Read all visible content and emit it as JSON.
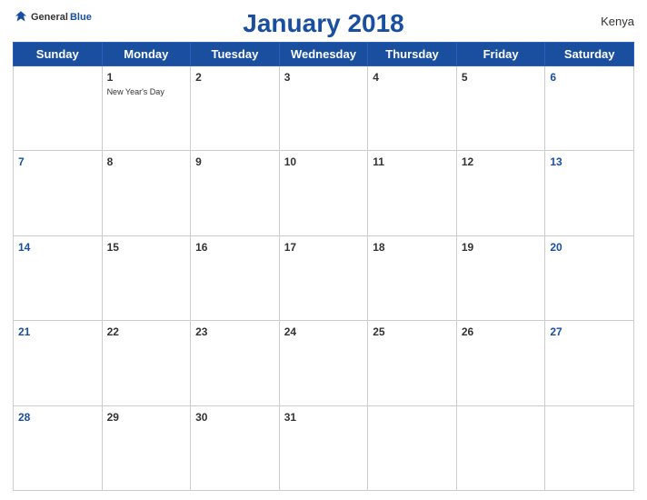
{
  "header": {
    "title": "January 2018",
    "country": "Kenya",
    "logo": {
      "general": "General",
      "blue": "Blue"
    }
  },
  "days_of_week": [
    "Sunday",
    "Monday",
    "Tuesday",
    "Wednesday",
    "Thursday",
    "Friday",
    "Saturday"
  ],
  "weeks": [
    [
      {
        "day": "",
        "empty": true
      },
      {
        "day": "1",
        "holiday": "New Year's Day"
      },
      {
        "day": "2"
      },
      {
        "day": "3"
      },
      {
        "day": "4"
      },
      {
        "day": "5"
      },
      {
        "day": "6"
      }
    ],
    [
      {
        "day": "7"
      },
      {
        "day": "8"
      },
      {
        "day": "9"
      },
      {
        "day": "10"
      },
      {
        "day": "11"
      },
      {
        "day": "12"
      },
      {
        "day": "13"
      }
    ],
    [
      {
        "day": "14"
      },
      {
        "day": "15"
      },
      {
        "day": "16"
      },
      {
        "day": "17"
      },
      {
        "day": "18"
      },
      {
        "day": "19"
      },
      {
        "day": "20"
      }
    ],
    [
      {
        "day": "21"
      },
      {
        "day": "22"
      },
      {
        "day": "23"
      },
      {
        "day": "24"
      },
      {
        "day": "25"
      },
      {
        "day": "26"
      },
      {
        "day": "27"
      }
    ],
    [
      {
        "day": "28"
      },
      {
        "day": "29"
      },
      {
        "day": "30"
      },
      {
        "day": "31"
      },
      {
        "day": ""
      },
      {
        "day": ""
      },
      {
        "day": ""
      }
    ]
  ]
}
